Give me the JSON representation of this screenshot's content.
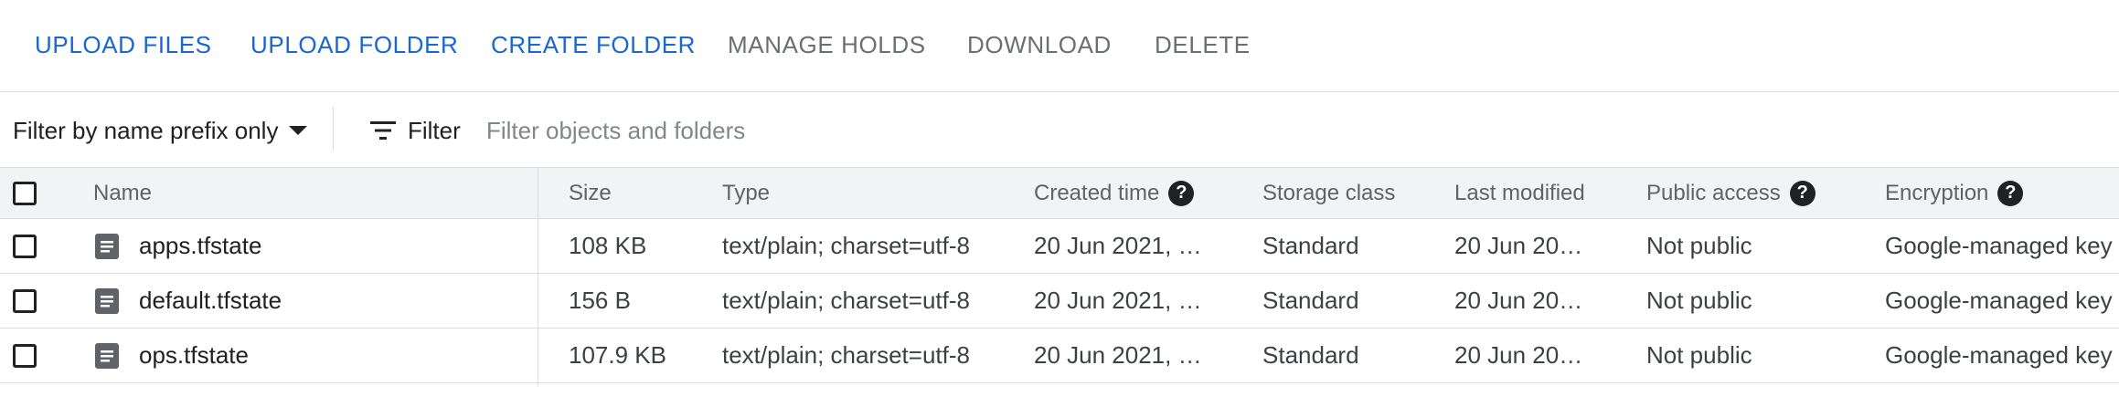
{
  "toolbar": {
    "upload_files": "UPLOAD FILES",
    "upload_folder": "UPLOAD FOLDER",
    "create_folder": "CREATE FOLDER",
    "manage_holds": "MANAGE HOLDS",
    "download": "DOWNLOAD",
    "delete": "DELETE"
  },
  "filter": {
    "prefix_mode": "Filter by name prefix only",
    "filter_label": "Filter",
    "placeholder": "Filter objects and folders"
  },
  "table": {
    "headers": {
      "name": "Name",
      "size": "Size",
      "type": "Type",
      "created": "Created time",
      "storage_class": "Storage class",
      "last_modified": "Last modified",
      "public_access": "Public access",
      "encryption": "Encryption"
    },
    "rows": [
      {
        "name": "apps.tfstate",
        "size": "108 KB",
        "type": "text/plain; charset=utf-8",
        "created": "20 Jun 2021, …",
        "storage_class": "Standard",
        "last_modified": "20 Jun 20…",
        "public_access": "Not public",
        "encryption": "Google-managed key"
      },
      {
        "name": "default.tfstate",
        "size": "156 B",
        "type": "text/plain; charset=utf-8",
        "created": "20 Jun 2021, …",
        "storage_class": "Standard",
        "last_modified": "20 Jun 20…",
        "public_access": "Not public",
        "encryption": "Google-managed key"
      },
      {
        "name": "ops.tfstate",
        "size": "107.9 KB",
        "type": "text/plain; charset=utf-8",
        "created": "20 Jun 2021, …",
        "storage_class": "Standard",
        "last_modified": "20 Jun 20…",
        "public_access": "Not public",
        "encryption": "Google-managed key"
      }
    ]
  },
  "icons": {
    "filter": "filter-lines-icon",
    "file": "text-file-icon",
    "help": "help-circle-icon"
  },
  "colors": {
    "accent": "#1967d2",
    "disabled": "#6b6e72",
    "header_bg": "#f1f3f4",
    "border": "#dadce0"
  },
  "help_glyph": "?"
}
